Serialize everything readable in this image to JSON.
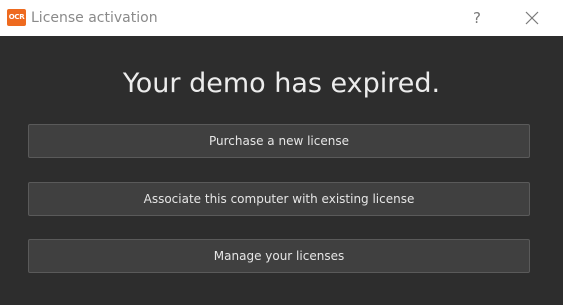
{
  "window": {
    "title": "License activation",
    "app_icon_text": "OCR",
    "help_label": "?",
    "brand_color": "#ee6a1f"
  },
  "main": {
    "headline": "Your demo has expired.",
    "buttons": [
      {
        "label": "Purchase a new license"
      },
      {
        "label": "Associate this computer with existing license"
      },
      {
        "label": "Manage your licenses"
      }
    ]
  }
}
